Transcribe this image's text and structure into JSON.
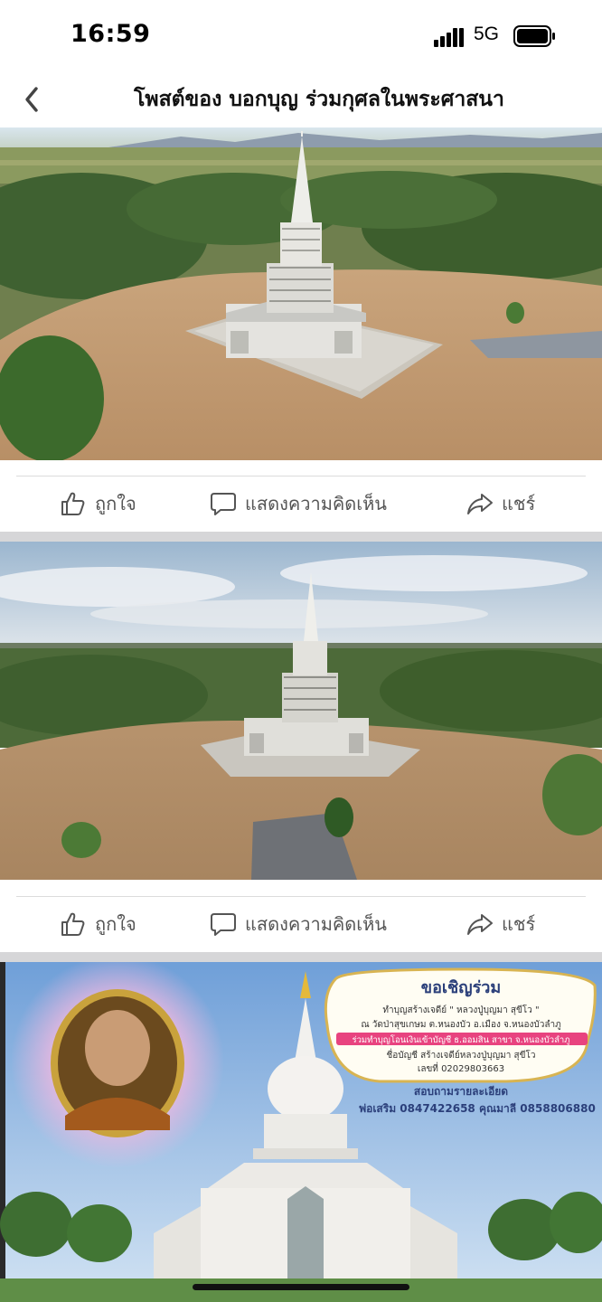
{
  "status_bar": {
    "time": "16:59",
    "network": "5G"
  },
  "header": {
    "title": "โพสต์ของ บอกบุญ  ร่วมกุศลในพระศาสนา"
  },
  "posts": [
    {
      "actions": {
        "like": "ถูกใจ",
        "comment": "แสดงความคิดเห็น",
        "share": "แชร์"
      }
    },
    {
      "actions": {
        "like": "ถูกใจ",
        "comment": "แสดงความคิดเห็น",
        "share": "แชร์"
      }
    }
  ],
  "poster": {
    "title": "ขอเชิญร่วม",
    "line1": "ทำบุญสร้างเจดีย์ \" หลวงปู่บุญมา สุขีโว \"",
    "line2": "ณ วัดป่าสุขเกษม ต.หนองบัว อ.เมือง จ.หนองบัวลำภู",
    "line3": "ร่วมทำบุญโอนเงินเข้าบัญชี ธ.ออมสิน สาขา จ.หนองบัวลำภู",
    "line4": "ชื่อบัญชี สร้างเจดีย์หลวงปู่บุญมา สุขีโว",
    "line5": "เลขที่ 020298036 63",
    "line5_display": "เลขที่ 02029803663",
    "inquire": "สอบถามรายละเอียด",
    "contacts": "พ่อเสริม 0847422658  คุณมาลี 0858806880"
  },
  "colors": {
    "divider": "#dcdcdc",
    "action_text": "#555555",
    "separator": "#d6d6d8"
  }
}
